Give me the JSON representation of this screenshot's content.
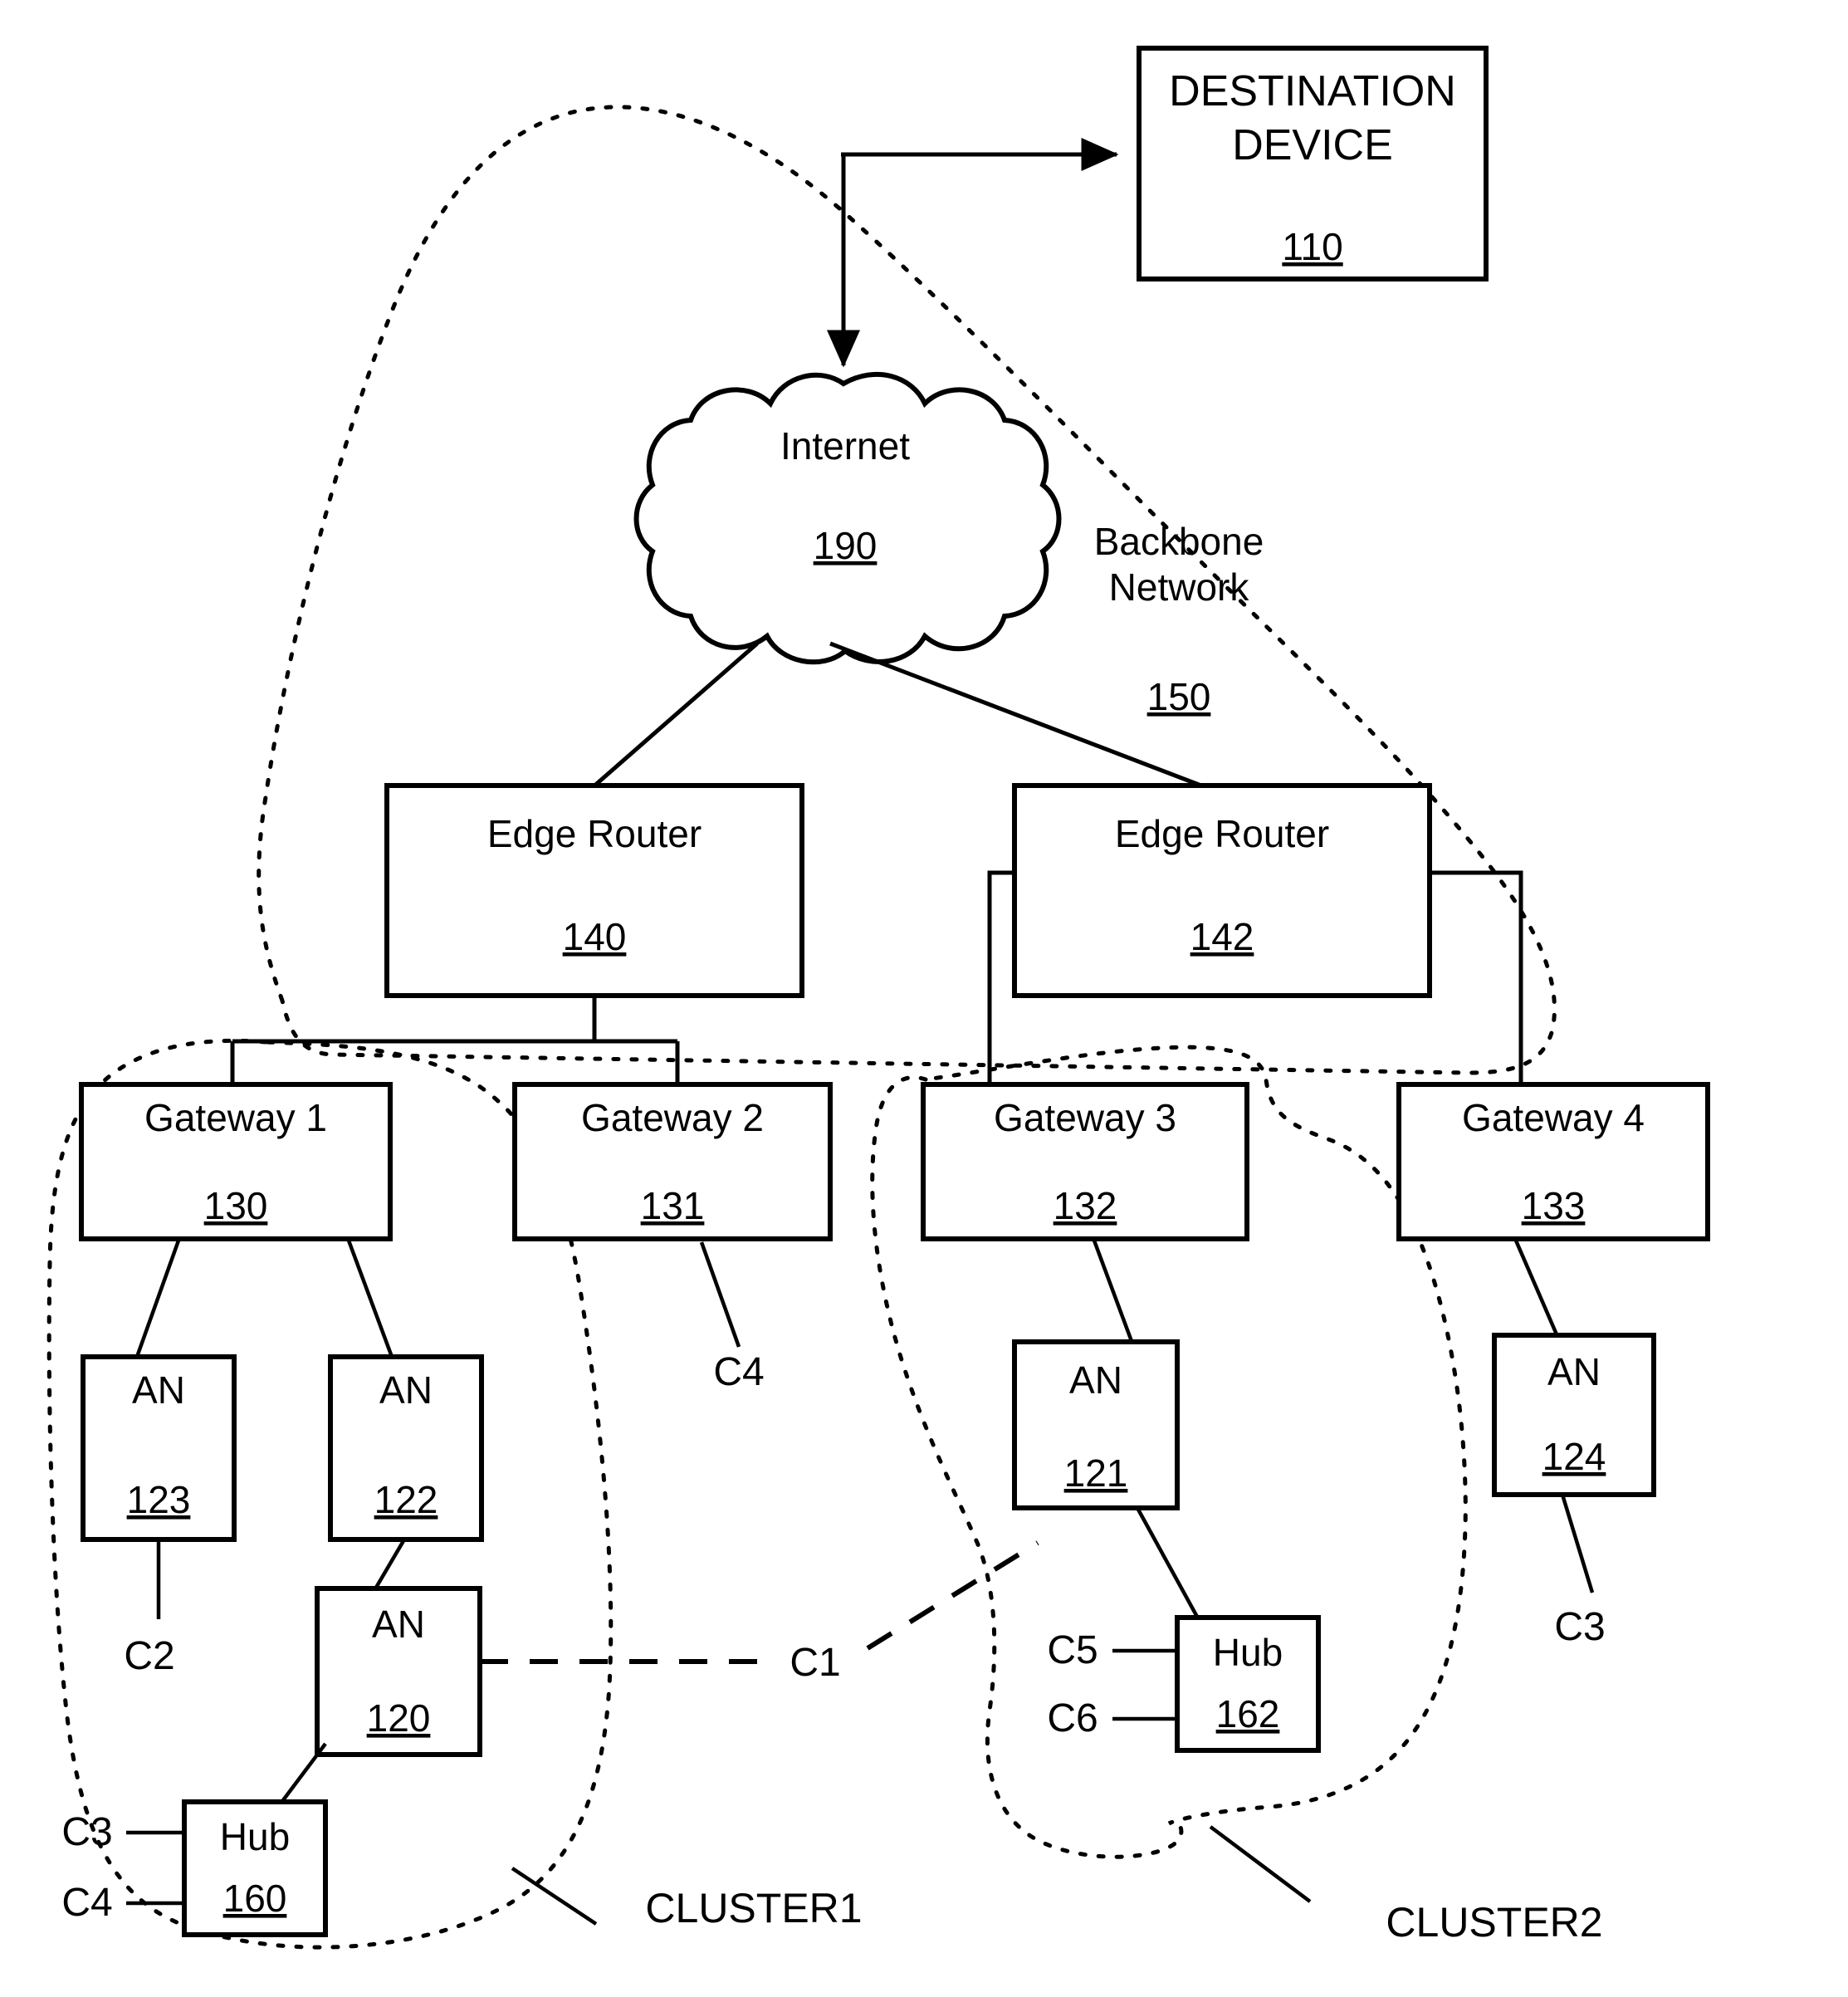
{
  "figure": {
    "title": "Network topology diagram with clusters",
    "background_color": "#ffffff",
    "line_color": "#000000"
  },
  "nodes": {
    "destination_device": {
      "label_line1": "DESTINATION",
      "label_line2": "DEVICE",
      "ref": "110"
    },
    "internet": {
      "label": "Internet",
      "ref": "190"
    },
    "backbone": {
      "label_line1": "Backbone",
      "label_line2": "Network",
      "ref": "150"
    },
    "edge_router_1": {
      "label": "Edge Router",
      "ref": "140"
    },
    "edge_router_2": {
      "label": "Edge Router",
      "ref": "142"
    },
    "gateway_1": {
      "label": "Gateway 1",
      "ref": "130"
    },
    "gateway_2": {
      "label": "Gateway 2",
      "ref": "131"
    },
    "gateway_3": {
      "label": "Gateway 3",
      "ref": "132"
    },
    "gateway_4": {
      "label": "Gateway 4",
      "ref": "133"
    },
    "an_123": {
      "label": "AN",
      "ref": "123"
    },
    "an_122": {
      "label": "AN",
      "ref": "122"
    },
    "an_120": {
      "label": "AN",
      "ref": "120"
    },
    "an_121": {
      "label": "AN",
      "ref": "121"
    },
    "an_124": {
      "label": "AN",
      "ref": "124"
    },
    "hub_160": {
      "label": "Hub",
      "ref": "160"
    },
    "hub_162": {
      "label": "Hub",
      "ref": "162"
    }
  },
  "clients": {
    "c1": "C1",
    "c2": "C2",
    "c3_hub160": "C3",
    "c4_hub160": "C4",
    "c4_gw2": "C4",
    "c3_an124": "C3",
    "c5": "C5",
    "c6": "C6"
  },
  "clusters": {
    "cluster1": "CLUSTER1",
    "cluster2": "CLUSTER2"
  }
}
